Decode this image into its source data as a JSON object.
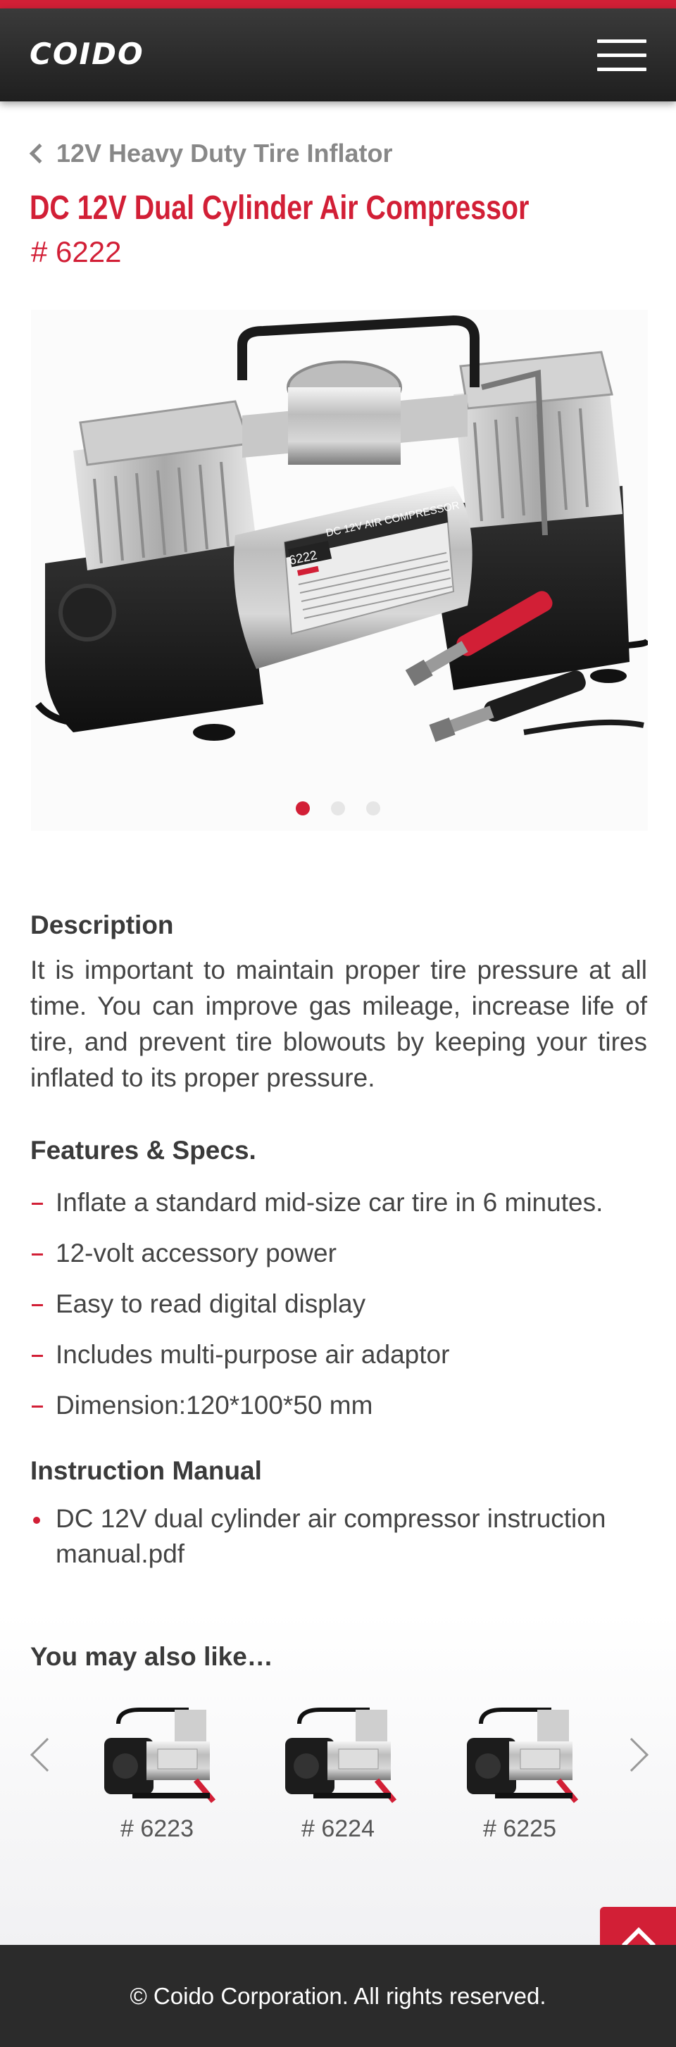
{
  "header": {
    "logo_text": "COIDO",
    "accent_color": "#d21f36"
  },
  "breadcrumb": {
    "back_label": "12V Heavy Duty Tire Inflator"
  },
  "product": {
    "title": "DC 12V Dual Cylinder Air Compressor",
    "sku": "# 6222",
    "label_on_unit": "6222",
    "label_banner": "DC 12V AIR COMPRESSOR",
    "carousel": {
      "count": 3,
      "active": 1
    }
  },
  "description": {
    "heading": "Description",
    "text": "It is important to maintain proper tire pressure at all time. You can improve gas mileage, increase life of tire, and prevent tire blowouts by keeping your tires inflated to its proper pressure."
  },
  "features": {
    "heading": "Features & Specs.",
    "items": [
      "Inflate a standard mid-size car tire in 6 minutes.",
      "12-volt accessory power",
      "Easy to read digital display",
      "Includes multi-purpose air adaptor",
      "Dimension:120*100*50 mm"
    ]
  },
  "manual": {
    "heading": "Instruction Manual",
    "items": [
      "DC 12V dual cylinder air compressor instruction manual.pdf"
    ]
  },
  "related": {
    "heading": "You may also like…",
    "items": [
      {
        "label": "# 6223"
      },
      {
        "label": "# 6224"
      },
      {
        "label": "# 6225"
      }
    ]
  },
  "footer": {
    "copyright": "© Coido Corporation. All rights reserved."
  }
}
